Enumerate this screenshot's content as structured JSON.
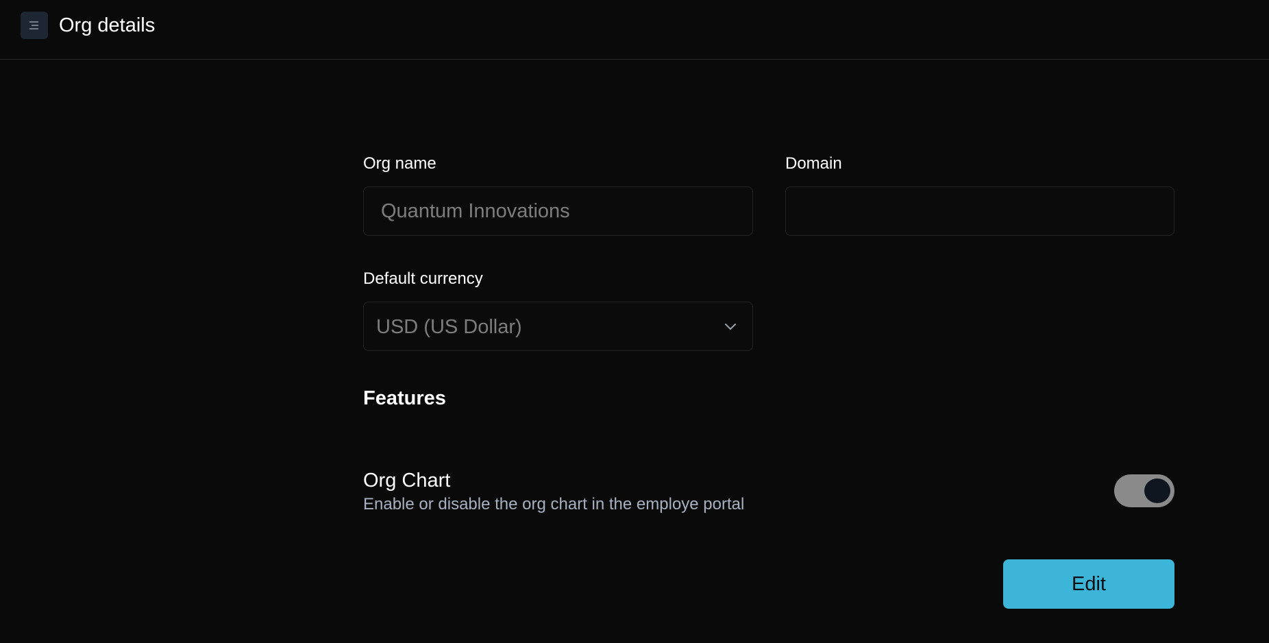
{
  "header": {
    "title": "Org details",
    "menu_icon": "menu-icon"
  },
  "form": {
    "org_name": {
      "label": "Org name",
      "placeholder": "Quantum Innovations",
      "value": ""
    },
    "domain": {
      "label": "Domain",
      "placeholder": "",
      "value": ""
    },
    "currency": {
      "label": "Default currency",
      "selected": "USD (US Dollar)",
      "icon": "chevron-down-icon"
    }
  },
  "features": {
    "title": "Features",
    "items": [
      {
        "title": "Org Chart",
        "description": "Enable or disable the org chart in the employe portal",
        "enabled": true
      }
    ]
  },
  "actions": {
    "edit_label": "Edit"
  },
  "colors": {
    "background": "#0a0a0a",
    "accent": "#3db5d8",
    "muted_text": "#a7b0c0",
    "toggle_track": "#8a8a8a"
  }
}
